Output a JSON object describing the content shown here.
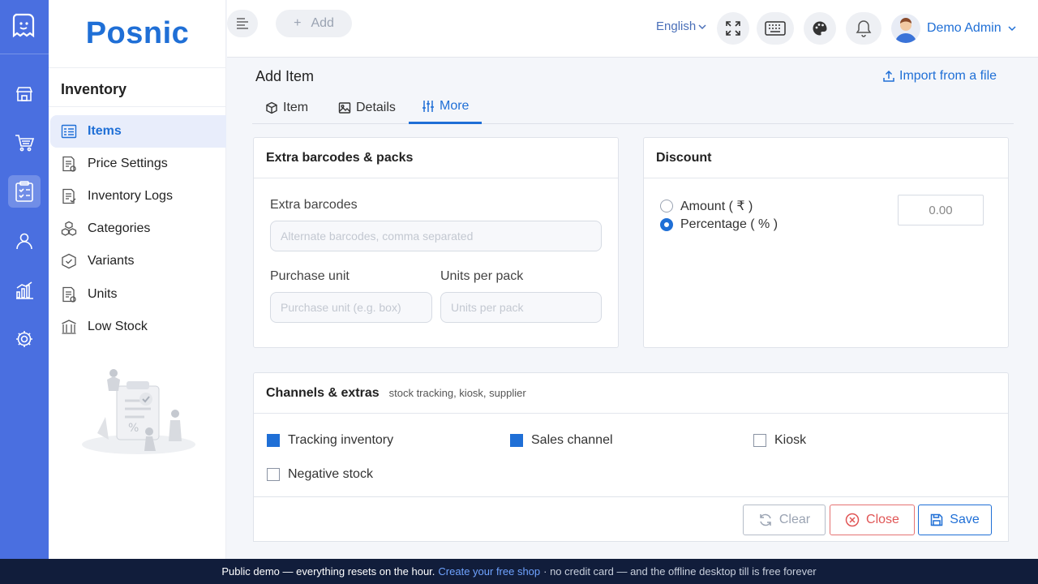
{
  "brand": "Posnic",
  "sidebar": {
    "title": "Inventory",
    "items": [
      {
        "label": "Items",
        "icon": "items-icon"
      },
      {
        "label": "Price Settings",
        "icon": "price-settings-icon"
      },
      {
        "label": "Inventory Logs",
        "icon": "inventory-logs-icon"
      },
      {
        "label": "Categories",
        "icon": "categories-icon"
      },
      {
        "label": "Variants",
        "icon": "variants-icon"
      },
      {
        "label": "Units",
        "icon": "units-icon"
      },
      {
        "label": "Low Stock",
        "icon": "low-stock-icon"
      }
    ]
  },
  "topbar": {
    "add_label": "Add",
    "language": "English",
    "user_name": "Demo Admin"
  },
  "page": {
    "title": "Add Item",
    "import_label": "Import from a file",
    "tabs": [
      "Item",
      "Details",
      "More"
    ]
  },
  "extra": {
    "title": "Extra barcodes & packs",
    "barcodes_label": "Extra barcodes",
    "barcodes_placeholder": "Alternate barcodes, comma separated",
    "purchase_unit_label": "Purchase unit",
    "purchase_unit_placeholder": "Purchase unit (e.g. box)",
    "units_per_pack_label": "Units per pack",
    "units_per_pack_placeholder": "Units per pack"
  },
  "discount": {
    "title": "Discount",
    "amount_label": "Amount ( ₹ )",
    "percentage_label": "Percentage ( % )",
    "value": "0.00"
  },
  "channels": {
    "title": "Channels & extras",
    "subtitle": "stock tracking, kiosk, supplier",
    "tracking": "Tracking inventory",
    "sales": "Sales channel",
    "kiosk": "Kiosk",
    "negative": "Negative stock"
  },
  "actions": {
    "clear": "Clear",
    "close": "Close",
    "save": "Save"
  },
  "banner": {
    "text": "Public demo — everything resets on the hour.",
    "link": "Create your free shop",
    "tail": "· no credit card — and the offline desktop till is free forever"
  },
  "colors": {
    "accent": "#1f6fd6",
    "rail": "#4a6fe0",
    "banner": "#111d3b",
    "danger": "#e05555"
  }
}
